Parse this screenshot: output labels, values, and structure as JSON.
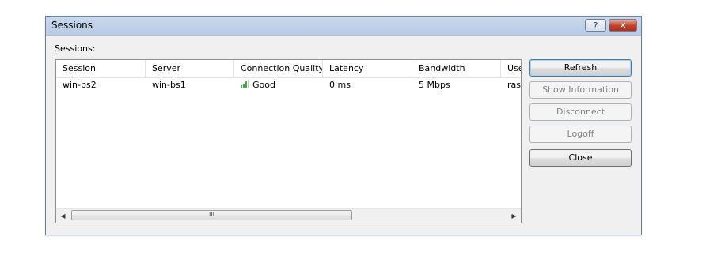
{
  "window": {
    "title": "Sessions",
    "help_glyph": "?",
    "close_glyph": "✕"
  },
  "sessions_label": "Sessions:",
  "table": {
    "columns": [
      "Session",
      "Server",
      "Connection Quality",
      "Latency",
      "Bandwidth",
      "Use"
    ],
    "rows": [
      {
        "session": "win-bs2",
        "server": "win-bs1",
        "quality": "Good",
        "latency": "0 ms",
        "bandwidth": "5 Mbps",
        "user": "ras"
      }
    ]
  },
  "scrollbar": {
    "left_arrow": "◀",
    "right_arrow": "▶",
    "thumb_grip": "III"
  },
  "buttons": {
    "refresh": "Refresh",
    "show_information": "Show Information",
    "disconnect": "Disconnect",
    "logoff": "Logoff",
    "close": "Close"
  },
  "colors": {
    "signal_good": "#3cb043",
    "signal_empty": "#c8c8c8"
  },
  "icons": {
    "quality": "signal-strength-icon"
  }
}
